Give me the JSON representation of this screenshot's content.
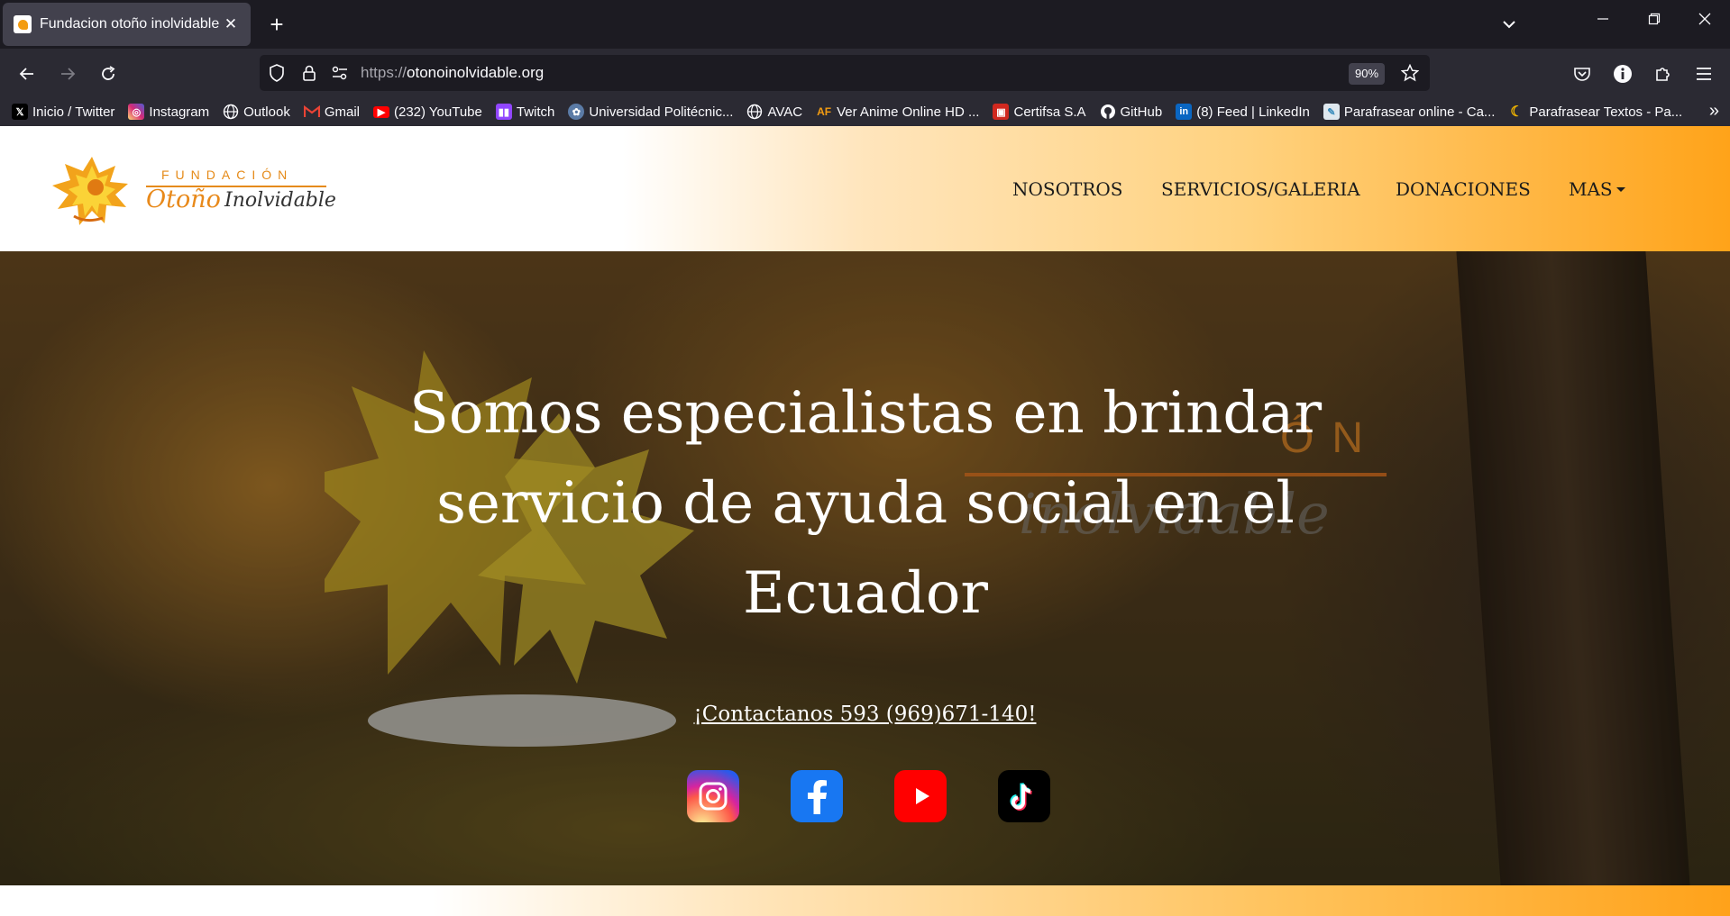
{
  "browser": {
    "tab": {
      "title": "Fundacion otoño inolvidable"
    },
    "url": {
      "protocol": "https://",
      "host": "otonoinolvidable.org"
    },
    "zoom": "90%",
    "bookmarks": [
      {
        "label": "Inicio / Twitter",
        "icon": "x-icon",
        "color": "#000000"
      },
      {
        "label": "Instagram",
        "icon": "instagram-icon",
        "color": "#d6249f"
      },
      {
        "label": "Outlook",
        "icon": "globe-icon",
        "color": "#2b2a33"
      },
      {
        "label": "Gmail",
        "icon": "gmail-icon",
        "color": "#ea4335"
      },
      {
        "label": "(232) YouTube",
        "icon": "youtube-icon",
        "color": "#ff0000"
      },
      {
        "label": "Twitch",
        "icon": "twitch-icon",
        "color": "#9146ff"
      },
      {
        "label": "Universidad Politécnic...",
        "icon": "university-icon",
        "color": "#5b7ba6"
      },
      {
        "label": "AVAC",
        "icon": "globe-icon",
        "color": "#2b2a33"
      },
      {
        "label": "Ver Anime Online HD ...",
        "icon": "af-icon",
        "color": "#2b2a33"
      },
      {
        "label": "Certifsa S.A",
        "icon": "certifsa-icon",
        "color": "#d0281f"
      },
      {
        "label": "GitHub",
        "icon": "github-icon",
        "color": "#2b2a33"
      },
      {
        "label": "(8) Feed | LinkedIn",
        "icon": "linkedin-icon",
        "color": "#0a66c2"
      },
      {
        "label": "Parafrasear online - Ca...",
        "icon": "paraphrase-icon",
        "color": "#3c8dbc"
      },
      {
        "label": "Parafrasear Textos - Pa...",
        "icon": "moon-icon",
        "color": "#f0b400"
      }
    ]
  },
  "site": {
    "logo": {
      "top": "FUNDACIÓN",
      "name_a": "Otoño",
      "name_b": "Inolvidable"
    },
    "menu": [
      {
        "label": "NOSOTROS"
      },
      {
        "label": "SERVICIOS/GALERIA"
      },
      {
        "label": "DONACIONES"
      },
      {
        "label": "MAS"
      }
    ],
    "hero": {
      "line1": "Somos especialistas en brindar",
      "line2": "servicio de ayuda social en el",
      "line3": "Ecuador",
      "contact": "¡Contactanos 593 (969)671-140!",
      "sign_text": "ÓN",
      "sign_script": "inolvidable"
    },
    "social": [
      {
        "name": "instagram",
        "color": "#d6249f"
      },
      {
        "name": "facebook",
        "color": "#1877f2"
      },
      {
        "name": "youtube",
        "color": "#ff0000"
      },
      {
        "name": "tiktok",
        "color": "#000000"
      }
    ]
  }
}
